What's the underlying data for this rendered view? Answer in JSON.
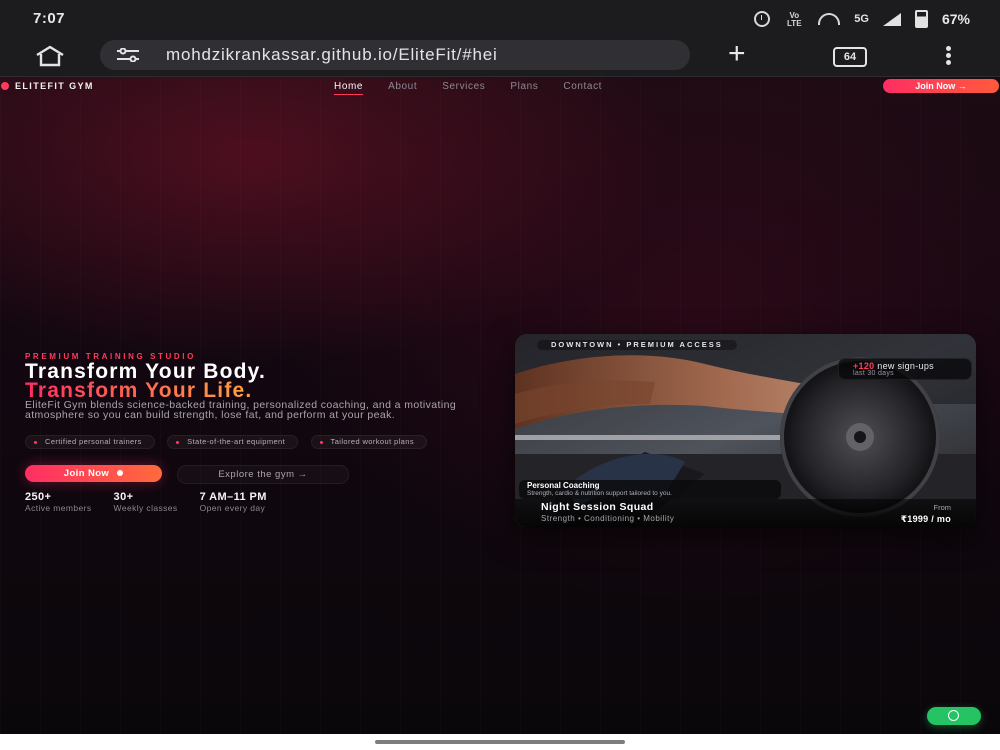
{
  "status_bar": {
    "time": "7:07",
    "network": "5G",
    "volte": "Vo LTE",
    "battery": "67%",
    "icons": [
      "alarm-icon",
      "volte-icon",
      "hotspot-icon",
      "signal-icon",
      "battery-icon"
    ]
  },
  "browser": {
    "url": "mohdzikrankassar.github.io/EliteFit/#hei",
    "tab_count": "64",
    "new_tab": "+",
    "icons": [
      "home-icon",
      "site-settings-icon",
      "new-tab-icon",
      "tab-switcher-icon",
      "overflow-menu-icon"
    ]
  },
  "site": {
    "brand": "ELITEFIT GYM",
    "nav": [
      {
        "label": "Home",
        "active": true
      },
      {
        "label": "About"
      },
      {
        "label": "Services"
      },
      {
        "label": "Plans"
      },
      {
        "label": "Contact"
      }
    ],
    "nav_cta": "Join Now",
    "hero": {
      "eyebrow": "PREMIUM TRAINING STUDIO",
      "title_line1": "Transform Your Body.",
      "title_line2": "Transform Your Life.",
      "description": "EliteFit Gym blends science-backed training, personalized coaching, and a motivating atmosphere so you can build strength, lose fat, and perform at your peak.",
      "features": [
        "Certified personal trainers",
        "State-of-the-art equipment",
        "Tailored workout plans"
      ],
      "primary_cta": "Join Now",
      "secondary_cta": "Explore the gym",
      "secondary_arrow": "→",
      "stats": [
        {
          "value": "250+",
          "label": "Active members"
        },
        {
          "value": "30+",
          "label": "Weekly classes"
        },
        {
          "value": "7 AM–11 PM",
          "label": "Open every day"
        }
      ]
    },
    "card": {
      "label": "DOWNTOWN • PREMIUM ACCESS",
      "signups_count": "+120",
      "signups_text": "new sign-ups",
      "signups_period": "last 30 days",
      "coaching_title": "Personal Coaching",
      "coaching_desc": "Strength, cardio & nutrition support tailored to you.",
      "session_name": "Night Session Squad",
      "session_tags": "Strength • Conditioning • Mobility",
      "price_prefix": "From",
      "price": "₹1999 / mo"
    },
    "fab_icon": "whatsapp-icon"
  },
  "colors": {
    "accent": "#ff2e63",
    "accent_orange": "#ffa940",
    "whatsapp": "#25c364",
    "page_bg": "#120710"
  }
}
